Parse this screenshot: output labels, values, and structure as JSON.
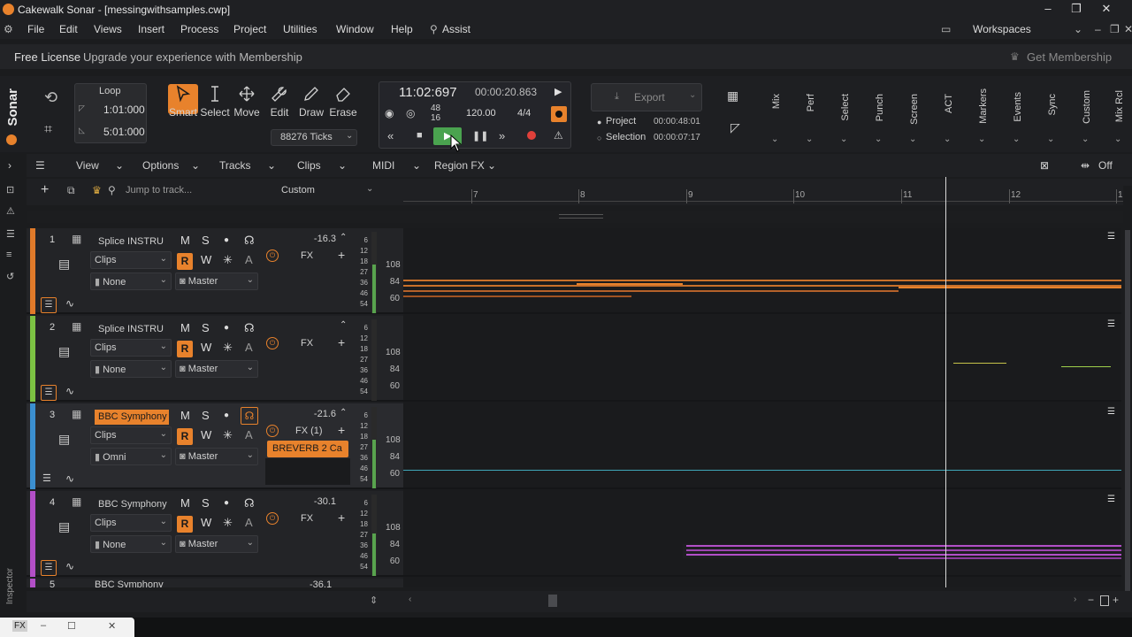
{
  "window": {
    "title": "Cakewalk Sonar - [messingwithsamples.cwp]",
    "minimize": "–",
    "restore": "❐",
    "close": "✕"
  },
  "menu": [
    "File",
    "Edit",
    "Views",
    "Insert",
    "Process",
    "Project",
    "Utilities",
    "Window",
    "Help",
    "Assist"
  ],
  "workspaces": {
    "label": "Workspaces"
  },
  "license": {
    "label": "Free License",
    "message": "Upgrade your experience with Membership",
    "get_membership": "Get Membership"
  },
  "brand": "Sonar",
  "loop": {
    "label": "Loop",
    "start": "1:01:000",
    "end": "5:01:000"
  },
  "tools": [
    "Smart",
    "Select",
    "Move",
    "Edit",
    "Draw",
    "Erase"
  ],
  "snap": {
    "value": "88276 Ticks"
  },
  "transport": {
    "position": "11:02:697",
    "time": "00:00:20.863",
    "meter_top": "48",
    "meter_bottom": "16",
    "tempo": "120.00",
    "time_sig": "4/4"
  },
  "export": {
    "label": "Export",
    "project_label": "Project",
    "project_time": "00:00:48:01",
    "selection_label": "Selection",
    "selection_time": "00:00:07:17"
  },
  "modules": [
    "Mix",
    "Perf",
    "Select",
    "Punch",
    "Screen",
    "ACT",
    "Markers",
    "Events",
    "Sync",
    "Custom",
    "Mix Rcl"
  ],
  "toolbar2": {
    "view": "View",
    "options": "Options",
    "tracks": "Tracks",
    "clips": "Clips",
    "midi": "MIDI",
    "region_fx": "Region FX",
    "off": "Off"
  },
  "jump": {
    "placeholder": "Jump to track...",
    "custom": "Custom"
  },
  "ruler": {
    "ticks": [
      "7",
      "8",
      "9",
      "10",
      "11",
      "12",
      "1"
    ]
  },
  "tracks": [
    {
      "num": "1",
      "name": "Splice INSTRU",
      "volume": "-16.3",
      "input": "None",
      "output": "Master",
      "mode": "Clips",
      "fx": "FX",
      "plugin": "",
      "color": "#e07a2a"
    },
    {
      "num": "2",
      "name": "Splice INSTRU",
      "volume": "",
      "input": "None",
      "output": "Master",
      "mode": "Clips",
      "fx": "FX",
      "plugin": "",
      "color": "#7cc243"
    },
    {
      "num": "3",
      "name": "BBC Symphony",
      "volume": "-21.6",
      "input": "Omni",
      "output": "Master",
      "mode": "Clips",
      "fx": "FX (1)",
      "plugin": "BREVERB 2 Ca",
      "color": "#3b8fd0"
    },
    {
      "num": "4",
      "name": "BBC Symphony",
      "volume": "-30.1",
      "input": "None",
      "output": "Master",
      "mode": "Clips",
      "fx": "FX",
      "plugin": "",
      "color": "#b24fc7"
    }
  ],
  "partial_track": {
    "num": "5",
    "name": "BBC Symphony",
    "volume": "-36.1"
  },
  "db_scale": [
    "6",
    "12",
    "18",
    "27",
    "36",
    "46",
    "54"
  ],
  "keys": [
    "108",
    "84",
    "60"
  ],
  "strip_labels": {
    "m": "M",
    "s": "S",
    "w": "W",
    "r": "R",
    "a": "A"
  },
  "inspector_label": "Inspector",
  "status": {
    "fx": "FX"
  }
}
